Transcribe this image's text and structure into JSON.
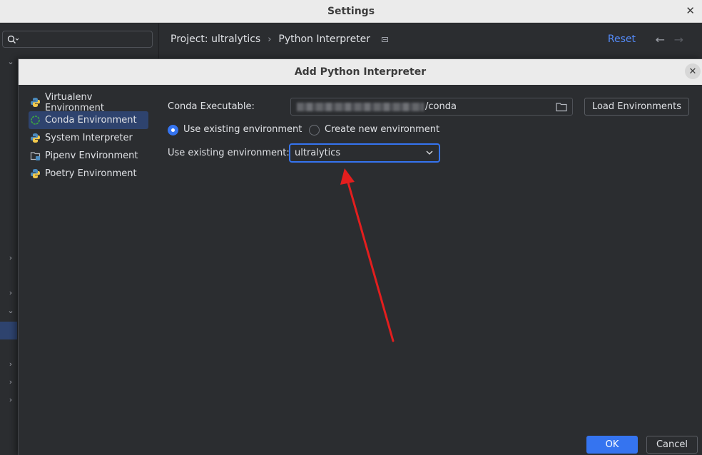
{
  "window": {
    "title": "Settings",
    "close_glyph": "✕"
  },
  "breadcrumb": {
    "project": "Project: ultralytics",
    "separator": "›",
    "page": "Python Interpreter"
  },
  "header": {
    "reset_label": "Reset",
    "back_glyph": "←",
    "forward_glyph": "→"
  },
  "dialog": {
    "title": "Add Python Interpreter",
    "close_glyph": "✕",
    "env_types": [
      {
        "label": "Virtualenv Environment",
        "icon": "python-icon"
      },
      {
        "label": "Conda Environment",
        "icon": "conda-icon"
      },
      {
        "label": "System Interpreter",
        "icon": "python-icon"
      },
      {
        "label": "Pipenv Environment",
        "icon": "pipenv-icon"
      },
      {
        "label": "Poetry Environment",
        "icon": "poetry-icon"
      }
    ],
    "selected_env_type": "Conda Environment",
    "conda_executable_label": "Conda Executable:",
    "conda_executable_value_suffix": "/conda",
    "load_environments_label": "Load Environments",
    "radio_use_existing": "Use existing environment",
    "radio_create_new": "Create new environment",
    "radio_selected": "use_existing",
    "existing_env_label": "Use existing environment:",
    "existing_env_value": "ultralytics",
    "ok_label": "OK",
    "cancel_label": "Cancel"
  },
  "colors": {
    "accent": "#3574f0",
    "link": "#548af7",
    "annotation_arrow": "#e31e1e",
    "background": "#2b2d30"
  }
}
